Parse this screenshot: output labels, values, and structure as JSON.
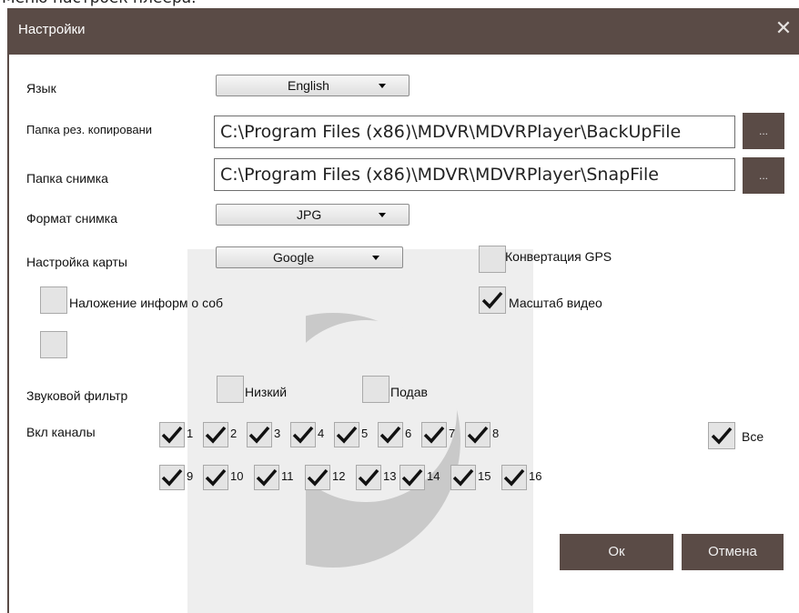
{
  "top_caption": "Меню настроек плеера.",
  "dialog": {
    "title": "Настройки"
  },
  "language": {
    "label": "Язык",
    "value": "English"
  },
  "backup_folder": {
    "label": "Папка рез. копировани",
    "value": "C:\\Program Files (x86)\\MDVR\\MDVRPlayer\\BackUpFile",
    "browse": "..."
  },
  "snapshot_folder": {
    "label": "Папка снимка",
    "value": "C:\\Program Files (x86)\\MDVR\\MDVRPlayer\\SnapFile",
    "browse": "..."
  },
  "snapshot_format": {
    "label": "Формат снимка",
    "value": "JPG"
  },
  "map_settings": {
    "label": "Настройка карты",
    "value": "Google"
  },
  "gps_conversion": {
    "label": "Конвертация GPS",
    "checked": false
  },
  "overlay_info": {
    "label": "Наложение информ о соб",
    "checked": false
  },
  "video_scale": {
    "label": "Масштаб видео",
    "checked": true
  },
  "extra_checkbox": {
    "checked": false
  },
  "audio_filter": {
    "label": "Звуковой фильтр",
    "low_label": "Низкий",
    "low_checked": false,
    "suppress_label": "Подав",
    "suppress_checked": false
  },
  "channels": {
    "label": "Вкл каналы",
    "row1": [
      "1",
      "2",
      "3",
      "4",
      "5",
      "6",
      "7",
      "8"
    ],
    "row2": [
      "9",
      "10",
      "11",
      "12",
      "13",
      "14",
      "15",
      "16"
    ],
    "all_label": "Все",
    "all_checked": true
  },
  "buttons": {
    "ok": "Ок",
    "cancel": "Отмена"
  },
  "colors": {
    "titlebar": "#5a4b46",
    "checkbox_bg": "#e4e4e4"
  },
  "icons": {
    "close": "close-icon",
    "check": "checkmark-icon",
    "dropdown": "chevron-down-icon"
  }
}
